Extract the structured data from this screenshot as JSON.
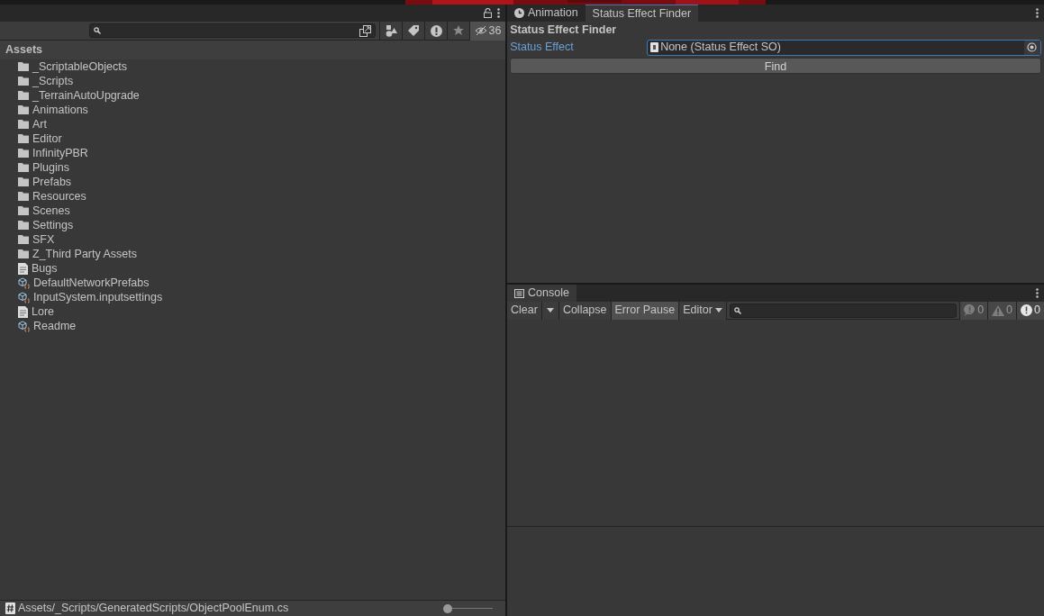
{
  "project": {
    "hidden_count": "36",
    "header": "Assets",
    "items": [
      {
        "label": "_ScriptableObjects",
        "kind": "folder"
      },
      {
        "label": "_Scripts",
        "kind": "folder"
      },
      {
        "label": "_TerrainAutoUpgrade",
        "kind": "folder"
      },
      {
        "label": "Animations",
        "kind": "folder"
      },
      {
        "label": "Art",
        "kind": "folder"
      },
      {
        "label": "Editor",
        "kind": "folder"
      },
      {
        "label": "InfinityPBR",
        "kind": "folder"
      },
      {
        "label": "Plugins",
        "kind": "folder"
      },
      {
        "label": "Prefabs",
        "kind": "folder"
      },
      {
        "label": "Resources",
        "kind": "folder"
      },
      {
        "label": "Scenes",
        "kind": "folder"
      },
      {
        "label": "Settings",
        "kind": "folder"
      },
      {
        "label": "SFX",
        "kind": "folder"
      },
      {
        "label": "Z_Third Party Assets",
        "kind": "folder"
      },
      {
        "label": "Bugs",
        "kind": "text"
      },
      {
        "label": "DefaultNetworkPrefabs",
        "kind": "asset"
      },
      {
        "label": "InputSystem.inputsettings",
        "kind": "asset"
      },
      {
        "label": "Lore",
        "kind": "text"
      },
      {
        "label": "Readme",
        "kind": "asset"
      }
    ],
    "status_path": "Assets/_Scripts/GeneratedScripts/ObjectPoolEnum.cs",
    "zoom": {
      "level": 0.0
    }
  },
  "finder": {
    "tabs": [
      {
        "label": "Animation",
        "selected": false
      },
      {
        "label": "Status Effect Finder",
        "selected": true
      }
    ],
    "title": "Status Effect Finder",
    "field_label": "Status Effect",
    "field_value": "None (Status Effect SO)",
    "button": "Find"
  },
  "console": {
    "tab": "Console",
    "buttons": [
      {
        "label": "Clear",
        "kind": "split",
        "selected": false
      },
      {
        "label": "Collapse",
        "kind": "toggle",
        "selected": false
      },
      {
        "label": "Error Pause",
        "kind": "toggle",
        "selected": true
      },
      {
        "label": "Editor",
        "kind": "dropdown",
        "selected": false
      }
    ],
    "counters": [
      {
        "kind": "info",
        "count": "0"
      },
      {
        "kind": "warning",
        "count": "0"
      },
      {
        "kind": "error",
        "count": "0"
      }
    ]
  }
}
